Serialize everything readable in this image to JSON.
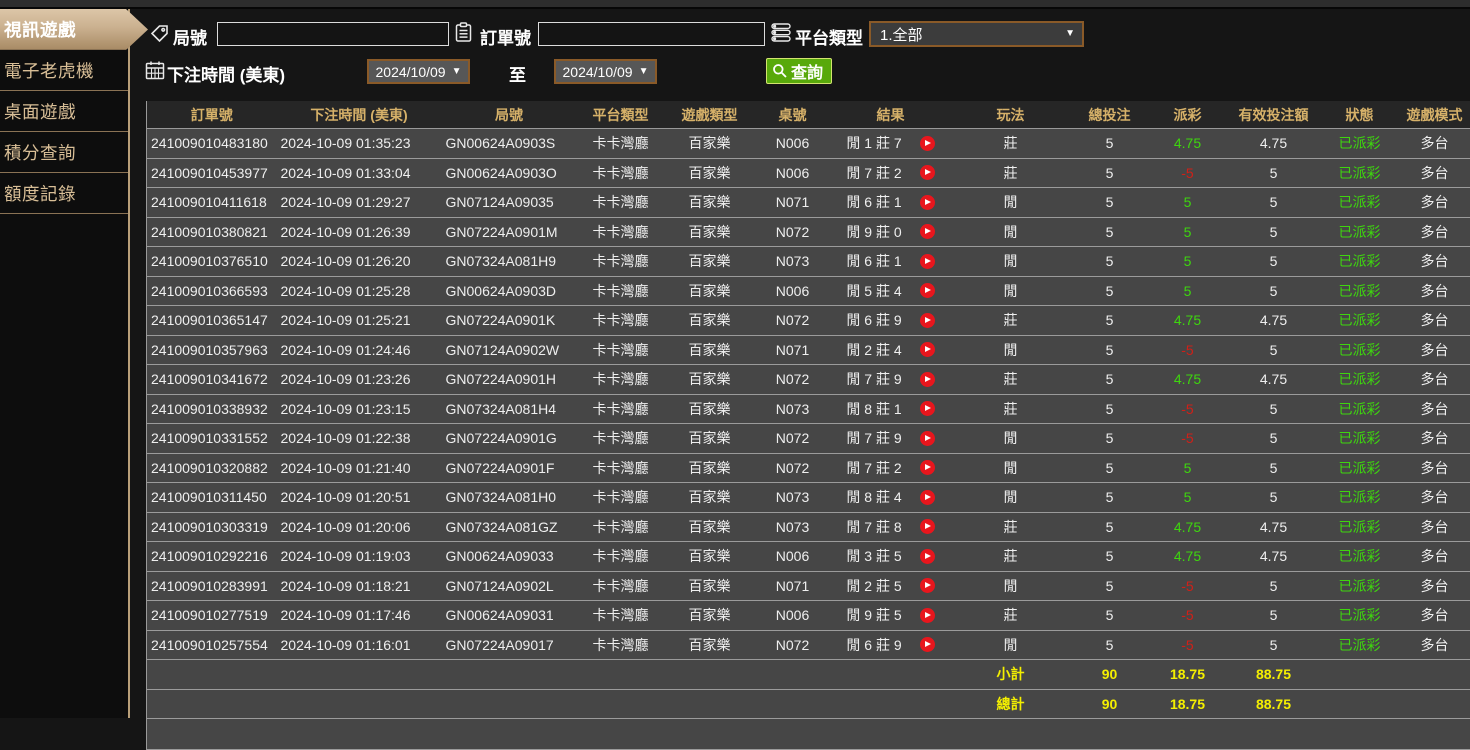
{
  "sidebar": {
    "items": [
      {
        "label": "視訊遊戲",
        "active": true
      },
      {
        "label": "電子老虎機",
        "active": false
      },
      {
        "label": "桌面遊戲",
        "active": false
      },
      {
        "label": "積分查詢",
        "active": false
      },
      {
        "label": "額度記錄",
        "active": false
      }
    ]
  },
  "filters": {
    "round": {
      "label": "局號",
      "value": "",
      "icon": "tag-icon"
    },
    "order": {
      "label": "訂單號",
      "value": "",
      "icon": "clipboard-icon"
    },
    "platform": {
      "label": "平台類型",
      "value": "1.全部",
      "icon": "list-icon",
      "dropdown_char": "▼"
    },
    "bet_time": {
      "label": "下注時間 (美東)",
      "from": "2024/10/09",
      "to_separator": "至",
      "to": "2024/10/09",
      "icon": "calendar-icon",
      "dropdown_char": "▼"
    },
    "search": {
      "label": "查詢",
      "icon": "magnifier-icon"
    }
  },
  "table": {
    "headers": [
      "訂單號",
      "下注時間 (美東)",
      "局號",
      "平台類型",
      "遊戲類型",
      "桌號",
      "結果",
      "玩法",
      "總投注",
      "派彩",
      "有效投注額",
      "狀態",
      "遊戲模式"
    ],
    "rows": [
      {
        "order_no": "241009010483180",
        "bet_time": "2024-10-09 01:35:23",
        "round_no": "GN00624A0903S",
        "platform": "卡卡灣廳",
        "game_type": "百家樂",
        "table_no": "N006",
        "result": "閒 1 莊 7",
        "bet_side": "莊",
        "total_bet": "5",
        "payout": "4.75",
        "valid_bet": "4.75",
        "status": "已派彩",
        "game_mode": "多台"
      },
      {
        "order_no": "241009010453977",
        "bet_time": "2024-10-09 01:33:04",
        "round_no": "GN00624A0903O",
        "platform": "卡卡灣廳",
        "game_type": "百家樂",
        "table_no": "N006",
        "result": "閒 7 莊 2",
        "bet_side": "莊",
        "total_bet": "5",
        "payout": "-5",
        "valid_bet": "5",
        "status": "已派彩",
        "game_mode": "多台"
      },
      {
        "order_no": "241009010411618",
        "bet_time": "2024-10-09 01:29:27",
        "round_no": "GN07124A09035",
        "platform": "卡卡灣廳",
        "game_type": "百家樂",
        "table_no": "N071",
        "result": "閒 6 莊 1",
        "bet_side": "閒",
        "total_bet": "5",
        "payout": "5",
        "valid_bet": "5",
        "status": "已派彩",
        "game_mode": "多台"
      },
      {
        "order_no": "241009010380821",
        "bet_time": "2024-10-09 01:26:39",
        "round_no": "GN07224A0901M",
        "platform": "卡卡灣廳",
        "game_type": "百家樂",
        "table_no": "N072",
        "result": "閒 9 莊 0",
        "bet_side": "閒",
        "total_bet": "5",
        "payout": "5",
        "valid_bet": "5",
        "status": "已派彩",
        "game_mode": "多台"
      },
      {
        "order_no": "241009010376510",
        "bet_time": "2024-10-09 01:26:20",
        "round_no": "GN07324A081H9",
        "platform": "卡卡灣廳",
        "game_type": "百家樂",
        "table_no": "N073",
        "result": "閒 6 莊 1",
        "bet_side": "閒",
        "total_bet": "5",
        "payout": "5",
        "valid_bet": "5",
        "status": "已派彩",
        "game_mode": "多台"
      },
      {
        "order_no": "241009010366593",
        "bet_time": "2024-10-09 01:25:28",
        "round_no": "GN00624A0903D",
        "platform": "卡卡灣廳",
        "game_type": "百家樂",
        "table_no": "N006",
        "result": "閒 5 莊 4",
        "bet_side": "閒",
        "total_bet": "5",
        "payout": "5",
        "valid_bet": "5",
        "status": "已派彩",
        "game_mode": "多台"
      },
      {
        "order_no": "241009010365147",
        "bet_time": "2024-10-09 01:25:21",
        "round_no": "GN07224A0901K",
        "platform": "卡卡灣廳",
        "game_type": "百家樂",
        "table_no": "N072",
        "result": "閒 6 莊 9",
        "bet_side": "莊",
        "total_bet": "5",
        "payout": "4.75",
        "valid_bet": "4.75",
        "status": "已派彩",
        "game_mode": "多台"
      },
      {
        "order_no": "241009010357963",
        "bet_time": "2024-10-09 01:24:46",
        "round_no": "GN07124A0902W",
        "platform": "卡卡灣廳",
        "game_type": "百家樂",
        "table_no": "N071",
        "result": "閒 2 莊 4",
        "bet_side": "閒",
        "total_bet": "5",
        "payout": "-5",
        "valid_bet": "5",
        "status": "已派彩",
        "game_mode": "多台"
      },
      {
        "order_no": "241009010341672",
        "bet_time": "2024-10-09 01:23:26",
        "round_no": "GN07224A0901H",
        "platform": "卡卡灣廳",
        "game_type": "百家樂",
        "table_no": "N072",
        "result": "閒 7 莊 9",
        "bet_side": "莊",
        "total_bet": "5",
        "payout": "4.75",
        "valid_bet": "4.75",
        "status": "已派彩",
        "game_mode": "多台"
      },
      {
        "order_no": "241009010338932",
        "bet_time": "2024-10-09 01:23:15",
        "round_no": "GN07324A081H4",
        "platform": "卡卡灣廳",
        "game_type": "百家樂",
        "table_no": "N073",
        "result": "閒 8 莊 1",
        "bet_side": "莊",
        "total_bet": "5",
        "payout": "-5",
        "valid_bet": "5",
        "status": "已派彩",
        "game_mode": "多台"
      },
      {
        "order_no": "241009010331552",
        "bet_time": "2024-10-09 01:22:38",
        "round_no": "GN07224A0901G",
        "platform": "卡卡灣廳",
        "game_type": "百家樂",
        "table_no": "N072",
        "result": "閒 7 莊 9",
        "bet_side": "閒",
        "total_bet": "5",
        "payout": "-5",
        "valid_bet": "5",
        "status": "已派彩",
        "game_mode": "多台"
      },
      {
        "order_no": "241009010320882",
        "bet_time": "2024-10-09 01:21:40",
        "round_no": "GN07224A0901F",
        "platform": "卡卡灣廳",
        "game_type": "百家樂",
        "table_no": "N072",
        "result": "閒 7 莊 2",
        "bet_side": "閒",
        "total_bet": "5",
        "payout": "5",
        "valid_bet": "5",
        "status": "已派彩",
        "game_mode": "多台"
      },
      {
        "order_no": "241009010311450",
        "bet_time": "2024-10-09 01:20:51",
        "round_no": "GN07324A081H0",
        "platform": "卡卡灣廳",
        "game_type": "百家樂",
        "table_no": "N073",
        "result": "閒 8 莊 4",
        "bet_side": "閒",
        "total_bet": "5",
        "payout": "5",
        "valid_bet": "5",
        "status": "已派彩",
        "game_mode": "多台"
      },
      {
        "order_no": "241009010303319",
        "bet_time": "2024-10-09 01:20:06",
        "round_no": "GN07324A081GZ",
        "platform": "卡卡灣廳",
        "game_type": "百家樂",
        "table_no": "N073",
        "result": "閒 7 莊 8",
        "bet_side": "莊",
        "total_bet": "5",
        "payout": "4.75",
        "valid_bet": "4.75",
        "status": "已派彩",
        "game_mode": "多台"
      },
      {
        "order_no": "241009010292216",
        "bet_time": "2024-10-09 01:19:03",
        "round_no": "GN00624A09033",
        "platform": "卡卡灣廳",
        "game_type": "百家樂",
        "table_no": "N006",
        "result": "閒 3 莊 5",
        "bet_side": "莊",
        "total_bet": "5",
        "payout": "4.75",
        "valid_bet": "4.75",
        "status": "已派彩",
        "game_mode": "多台"
      },
      {
        "order_no": "241009010283991",
        "bet_time": "2024-10-09 01:18:21",
        "round_no": "GN07124A0902L",
        "platform": "卡卡灣廳",
        "game_type": "百家樂",
        "table_no": "N071",
        "result": "閒 2 莊 5",
        "bet_side": "閒",
        "total_bet": "5",
        "payout": "-5",
        "valid_bet": "5",
        "status": "已派彩",
        "game_mode": "多台"
      },
      {
        "order_no": "241009010277519",
        "bet_time": "2024-10-09 01:17:46",
        "round_no": "GN00624A09031",
        "platform": "卡卡灣廳",
        "game_type": "百家樂",
        "table_no": "N006",
        "result": "閒 9 莊 5",
        "bet_side": "莊",
        "total_bet": "5",
        "payout": "-5",
        "valid_bet": "5",
        "status": "已派彩",
        "game_mode": "多台"
      },
      {
        "order_no": "241009010257554",
        "bet_time": "2024-10-09 01:16:01",
        "round_no": "GN07224A09017",
        "platform": "卡卡灣廳",
        "game_type": "百家樂",
        "table_no": "N072",
        "result": "閒 6 莊 9",
        "bet_side": "閒",
        "total_bet": "5",
        "payout": "-5",
        "valid_bet": "5",
        "status": "已派彩",
        "game_mode": "多台"
      }
    ],
    "subtotal": {
      "label": "小計",
      "total_bet": "90",
      "payout": "18.75",
      "valid_bet": "88.75"
    },
    "grand_total": {
      "label": "總計",
      "total_bet": "90",
      "payout": "18.75",
      "valid_bet": "88.75"
    },
    "play_icon": "play-icon"
  },
  "colors": {
    "header_gold": "#d6b169",
    "positive_green": "#3ed60e",
    "negative_red": "#cf2018",
    "status_green": "#3ed60e",
    "summary_yellow": "#f4ef00",
    "button_green": "#58a90b",
    "sidebar_tan": "#d3b68f",
    "select_border_brown": "#8a5a28",
    "row_grey": "#464646",
    "play_icon_red": "#e8161d"
  }
}
